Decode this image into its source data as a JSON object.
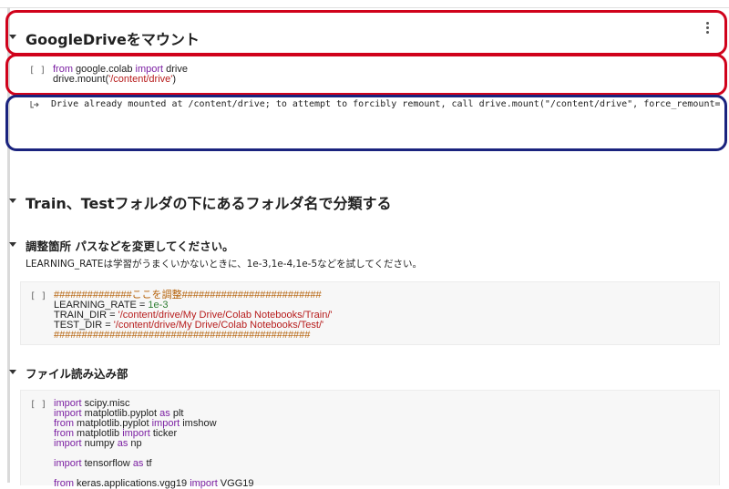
{
  "section1": {
    "title": "GoogleDriveをマウント",
    "cell": {
      "prompt": "[ ]",
      "line1_kw": "from",
      "line1_mod": " google.colab ",
      "line1_kw2": "import",
      "line1_name": " drive",
      "line2_pre": "drive.mount(",
      "line2_str": "'/content/drive'",
      "line2_post": ")"
    },
    "output": "Drive already mounted at /content/drive; to attempt to forcibly remount, call drive.mount(\"/content/drive\", force_remount=True)."
  },
  "section2": {
    "title": "Train、Testフォルダの下にあるフォルダ名で分類する"
  },
  "section3": {
    "title": "調整箇所 パスなどを変更してください。",
    "description": "LEARNING_RATEは学習がうまくいかないときに、1e-3,1e-4,1e-5などを試してください。",
    "cell": {
      "prompt": "[ ]",
      "comment1": "##############ここを調整#########################",
      "lr_pre": "LEARNING_RATE = ",
      "lr_val": "1e-3",
      "train_pre": "TRAIN_DIR = ",
      "train_str": "'/content/drive/My Drive/Colab Notebooks/Train/'",
      "test_pre": "TEST_DIR = ",
      "test_str": "'/content/drive/My Drive/Colab Notebooks/Test/'",
      "comment2": "##############################################"
    }
  },
  "section4": {
    "title": "ファイル読み込み部",
    "cell": {
      "prompt": "[ ]",
      "l1_kw": "import",
      "l1_rest": " scipy.misc",
      "l2_kw": "import",
      "l2_mid": " matplotlib.pyplot ",
      "l2_as": "as",
      "l2_rest": " plt",
      "l3_kw": "from",
      "l3_mid": " matplotlib.pyplot ",
      "l3_kw2": "import",
      "l3_rest": " imshow",
      "l4_kw": "from",
      "l4_mid": " matplotlib ",
      "l4_kw2": "import",
      "l4_rest": " ticker",
      "l5_kw": "import",
      "l5_mid": " numpy ",
      "l5_as": "as",
      "l5_rest": " np",
      "l6_kw": "import",
      "l6_mid": " tensorflow ",
      "l6_as": "as",
      "l6_rest": " tf",
      "l7_kw": "from",
      "l7_mid": " keras.applications.vgg19 ",
      "l7_kw2": "import",
      "l7_rest": " VGG19"
    }
  },
  "colors": {
    "annotation_red": "#d0021b",
    "annotation_blue": "#1a237e",
    "keyword": "#7b1fa2",
    "string": "#b71c1c",
    "number": "#2e7d32",
    "comment": "#b45f06"
  },
  "icons": {
    "collapse": "triangle-down-icon",
    "menu": "kebab-menu-icon",
    "output": "output-arrow-icon"
  }
}
